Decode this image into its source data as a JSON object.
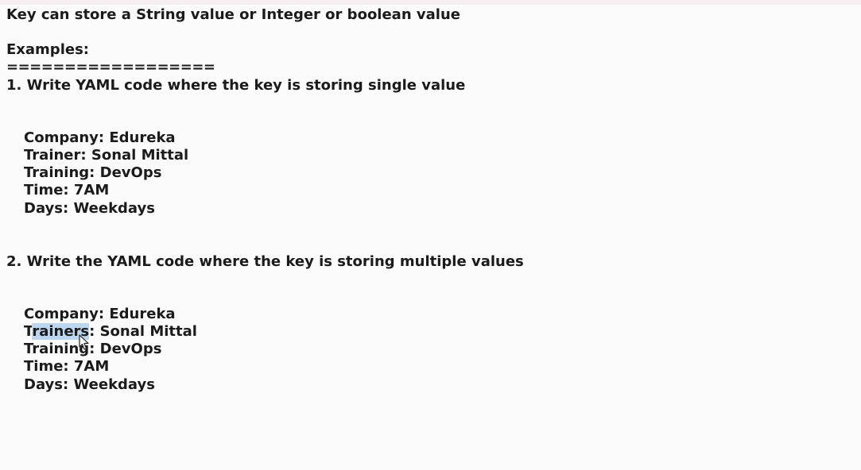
{
  "intro": "Key can store a String value or Integer or boolean value",
  "examples_label": "Examples:",
  "separator": "==================",
  "example1": {
    "heading": "1. Write YAML code where the key is storing single value",
    "lines": [
      "Company: Edureka",
      "Trainer: Sonal Mittal",
      "Training: DevOps",
      "Time: 7AM",
      "Days: Weekdays"
    ]
  },
  "example2": {
    "heading": "2. Write the YAML code where the key is storing multiple values",
    "lines": [
      "Company: Edureka",
      "Trainers: Sonal Mittal",
      "Training: DevOps",
      "Time: 7AM",
      "Days: Weekdays"
    ],
    "trainers_prefix": "T",
    "trainers_selected": "rainers",
    "trainers_suffix": ": Sonal Mittal"
  },
  "colors": {
    "text": "#1b1b1b",
    "selection": "#bcd6ef",
    "background": "#fbfbfb"
  }
}
